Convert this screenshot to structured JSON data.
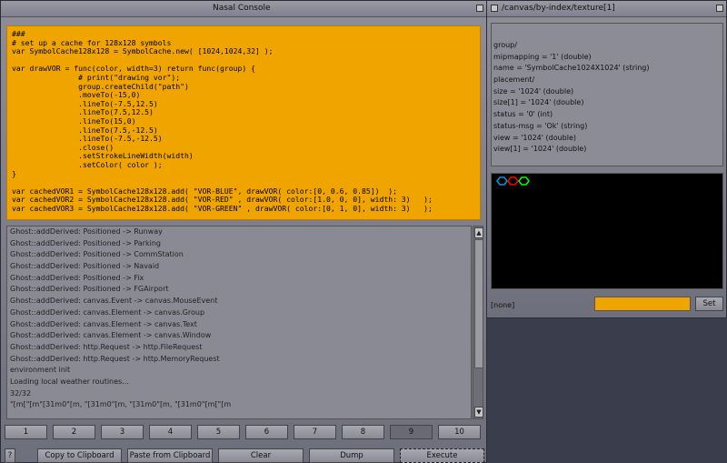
{
  "console": {
    "title": "Nasal Console",
    "code_lines": [
      "###",
      "# set up a cache for 128x128 symbols",
      "var SymbolCache128x128 = SymbolCache.new( [1024,1024,32] );",
      "",
      "var drawVOR = func(color, width=3) return func(group) {",
      "               # print(\"drawing vor\");",
      "               group.createChild(\"path\")",
      "               .moveTo(-15,0)",
      "               .lineTo(-7.5,12.5)",
      "               .lineTo(7.5,12.5)",
      "               .lineTo(15,0)",
      "               .lineTo(7.5,-12.5)",
      "               .lineTo(-7.5,-12.5)",
      "               .close()",
      "               .setStrokeLineWidth(width)",
      "               .setColor( color );",
      "}",
      "",
      "var cachedVOR1 = SymbolCache128x128.add( \"VOR-BLUE\", drawVOR( color:[0, 0.6, 0.85])  );",
      "var cachedVOR2 = SymbolCache128x128.add( \"VOR-RED\" , drawVOR( color:[1.0, 0, 0], width: 3)   );",
      "var cachedVOR3 = SymbolCache128x128.add( \"VOR-GREEN\" , drawVOR( color:[0, 1, 0], width: 3)   );"
    ],
    "log_lines": [
      "Ghost::addDerived: Positioned -> Runway",
      "Ghost::addDerived: Positioned -> Parking",
      "Ghost::addDerived: Positioned -> CommStation",
      "Ghost::addDerived: Positioned -> Navaid",
      "Ghost::addDerived: Positioned -> Fix",
      "Ghost::addDerived: Positioned -> FGAirport",
      "Ghost::addDerived: canvas.Event -> canvas.MouseEvent",
      "Ghost::addDerived: canvas.Element -> canvas.Group",
      "Ghost::addDerived: canvas.Element -> canvas.Text",
      "Ghost::addDerived: canvas.Element -> canvas.Window",
      "Ghost::addDerived: http.Request -> http.FileRequest",
      "Ghost::addDerived: http.Request -> http.MemoryRequest",
      "environment init",
      "Loading local weather routines...",
      "32/32",
      "\"[m[\"[m\"[31m0\"[m, \"[31m0\"[m, \"[31m0\"[m, \"[31m0\"[m[\"[m"
    ],
    "tabs": [
      "1",
      "2",
      "3",
      "4",
      "5",
      "6",
      "7",
      "8",
      "9",
      "10"
    ],
    "active_tab": "9",
    "help_label": "?",
    "buttons": {
      "copy": "Copy to Clipboard",
      "paste": "Paste from Clipboard",
      "clear": "Clear",
      "dump": "Dump",
      "execute": "Execute"
    },
    "code_bg": "#f0a400"
  },
  "inspector": {
    "title": "/canvas/by-index/texture[1]",
    "properties": [
      "group/",
      "mipmapping = '1' (double)",
      "name = 'SymbolCache1024X1024' (string)",
      "placement/",
      "size = '1024' (double)",
      "size[1] = '1024' (double)",
      "status = '0' (int)",
      "status-msg = 'Ok' (string)",
      "view = '1024' (double)",
      "view[1] = '1024' (double)"
    ],
    "selected_label": "[none]",
    "set_label": "Set",
    "symbol_colors": [
      "#0099d9",
      "#ff0000",
      "#00ff00"
    ]
  }
}
